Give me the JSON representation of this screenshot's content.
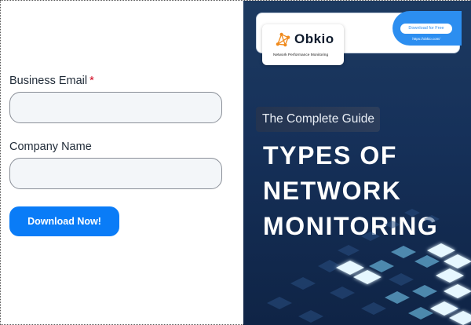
{
  "form": {
    "email_label": "Business Email",
    "required_mark": "*",
    "email_value": "",
    "company_label": "Company Name",
    "company_value": "",
    "submit_label": "Download Now!"
  },
  "cover": {
    "download_button": "Download for Free",
    "url": "https://obkio.com/",
    "brand": "Obkio",
    "tagline": "Network Performance Monitoring",
    "subtitle": "The Complete Guide",
    "title_lines": [
      "TYPES OF",
      "NETWORK",
      "MONITORING"
    ],
    "colors": {
      "brand_blue": "#2c8ef0",
      "cover_bg": "#16315a",
      "logo_orange": "#f08a1c",
      "button_blue": "#0a7cf7"
    }
  }
}
